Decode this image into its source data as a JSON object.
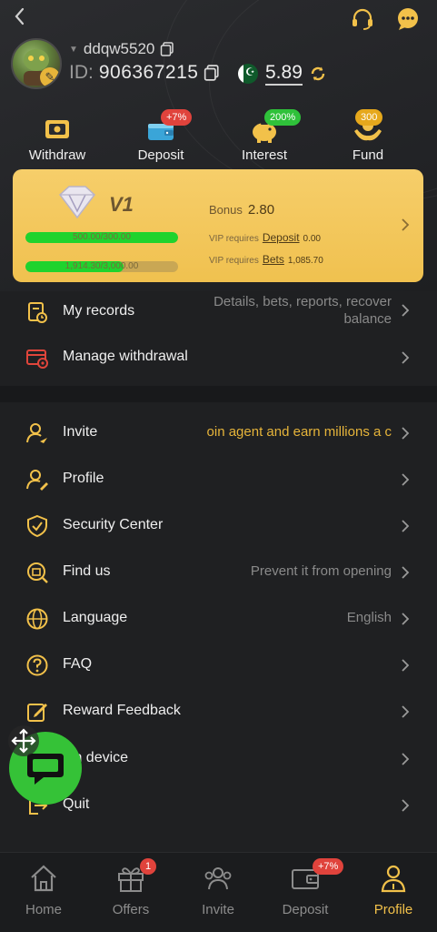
{
  "header": {
    "username": "ddqw5520",
    "id_label": "ID:",
    "id_value": "906367215",
    "balance": "5.89"
  },
  "quick_actions": [
    {
      "label": "Withdraw",
      "badge": ""
    },
    {
      "label": "Deposit",
      "badge": "+7%"
    },
    {
      "label": "Interest",
      "badge": "200%"
    },
    {
      "label": "Fund",
      "badge": "300"
    }
  ],
  "vip": {
    "level": "V1",
    "progress1_text": "500.00/300.00",
    "progress1_fraction": 1.0,
    "progress2_text": "1,914.30/3,000.00",
    "progress2_fraction": 0.64,
    "bonus_label": "Bonus",
    "bonus_value": "2.80",
    "req_deposit_prefix": "VIP requires",
    "req_deposit_link": "Deposit",
    "req_deposit_value": "0.00",
    "req_bets_prefix": "VIP requires",
    "req_bets_link": "Bets",
    "req_bets_value": "1,085.70"
  },
  "records": {
    "my_records_label": "My records",
    "my_records_value": "Details, bets, reports, recover balance",
    "manage_withdrawal_label": "Manage withdrawal"
  },
  "menu": [
    {
      "label": "Invite",
      "value": "oin agent and earn millions a c",
      "icon": "invite-icon"
    },
    {
      "label": "Profile",
      "value": "",
      "icon": "profile-icon"
    },
    {
      "label": "Security Center",
      "value": "",
      "icon": "shield-icon"
    },
    {
      "label": "Find us",
      "value": "Prevent it from opening",
      "icon": "building-search-icon"
    },
    {
      "label": "Language",
      "value": "English",
      "icon": "globe-icon"
    },
    {
      "label": "FAQ",
      "value": "",
      "icon": "question-icon"
    },
    {
      "label": "Reward Feedback",
      "value": "",
      "icon": "edit-icon"
    },
    {
      "label": "gin device",
      "value": "",
      "icon": "device-icon"
    },
    {
      "label": "Quit",
      "value": "",
      "icon": "logout-icon"
    }
  ],
  "tabs": [
    {
      "label": "Home",
      "badge": "",
      "active": false
    },
    {
      "label": "Offers",
      "badge": "1",
      "active": false
    },
    {
      "label": "Invite",
      "badge": "",
      "active": false
    },
    {
      "label": "Deposit",
      "badge": "+7%",
      "active": false
    },
    {
      "label": "Profile",
      "badge": "",
      "active": true
    }
  ],
  "colors": {
    "accent": "#f2c14a",
    "card": "#f3c85d",
    "progress": "#1fd32d",
    "badge_red": "#e0433c",
    "badge_green": "#2fc13a",
    "chat_fab": "#35c237"
  }
}
